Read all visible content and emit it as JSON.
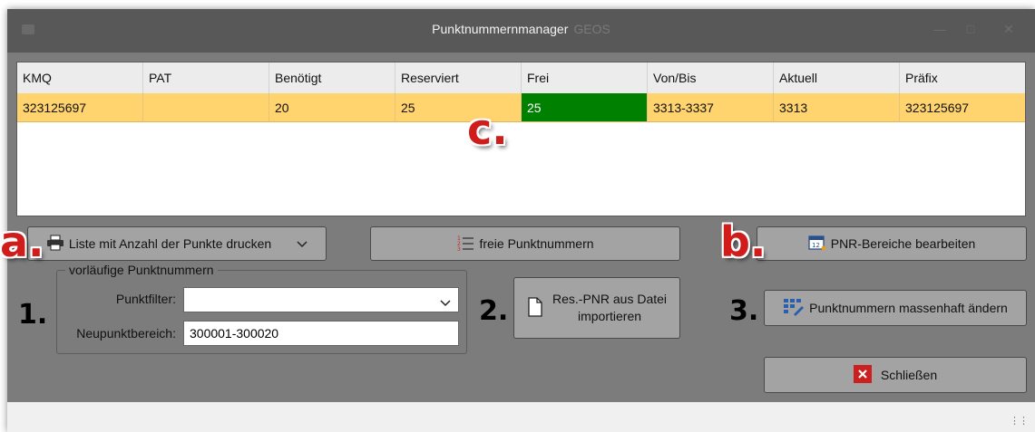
{
  "window": {
    "title": "Punktnummernmanager",
    "subtitle": "GEOS",
    "minimize_icon": "minimize-icon",
    "maximize_icon": "maximize-icon",
    "close_icon": "close-icon"
  },
  "grid": {
    "columns": [
      "KMQ",
      "PAT",
      "Benötigt",
      "Reserviert",
      "Frei",
      "Von/Bis",
      "Aktuell",
      "Präfix"
    ],
    "rows": [
      [
        "323125697",
        "",
        "20",
        "25",
        "25",
        "3313-3337",
        "3313",
        "323125697"
      ]
    ]
  },
  "annotations": {
    "a": "a.",
    "b": "b.",
    "c": "c."
  },
  "steps": {
    "one": "1.",
    "two": "2.",
    "three": "3."
  },
  "buttons": {
    "print_list": "Liste mit Anzahl der Punkte drucken",
    "free_numbers": "freie Punktnummern",
    "edit_ranges": "PNR-Bereiche bearbeiten",
    "import_line1": "Res.-PNR aus Datei",
    "import_line2": "importieren",
    "mass_change": "Punktnummern massenhaft ändern",
    "close": "Schließen"
  },
  "preliminary": {
    "group_title": "vorläufige Punktnummern",
    "filter_label": "Punktfilter:",
    "filter_value": "",
    "range_label": "Neupunktbereich:",
    "range_value": "300001-300020"
  },
  "colors": {
    "row_highlight": "#ffd36e",
    "free_cell": "#008000",
    "close_icon_bg": "#cc1f1f"
  }
}
